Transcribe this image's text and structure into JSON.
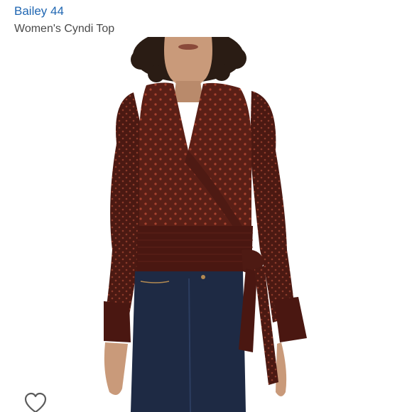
{
  "listing": {
    "brand": "Bailey 44",
    "title": "Women's Cyndi Top"
  },
  "icons": {
    "favorite": "heart-outline-icon"
  },
  "colors": {
    "brand_link": "#1f66b2",
    "title_text": "#4a4a4a",
    "top_fabric": "#5a1f16",
    "polka_dot": "#a8432f",
    "denim": "#1e2a44",
    "skin": "#c99a7a",
    "hair": "#2a1c14"
  }
}
